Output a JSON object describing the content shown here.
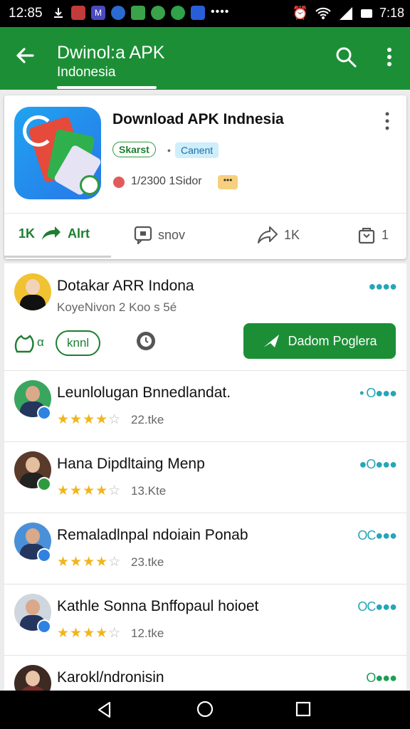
{
  "status_bar": {
    "time": "12:85",
    "right_time": "7:18",
    "icons": [
      "download-icon",
      "flag-icon",
      "m-icon",
      "shield-icon",
      "chat-icon",
      "whatsapp-icon",
      "leaf-icon",
      "calendar-icon",
      "more-dots-icon"
    ],
    "right_icons": [
      "alarm-icon",
      "wifi-icon",
      "signal-icon",
      "battery-icon"
    ]
  },
  "app_bar": {
    "title": "Dwinol:a APK",
    "subtitle": "Indonesia"
  },
  "app_card": {
    "title": "Download APK Indnesia",
    "tag_primary": "Skarst",
    "tag_secondary": "Canent",
    "info_text": "1/2300 1Sidor",
    "info_badge": "•••",
    "actions": [
      {
        "count": "1K",
        "label": "Alrt"
      },
      {
        "label": "snov"
      },
      {
        "label": "1K"
      },
      {
        "label": "1"
      }
    ]
  },
  "first_row": {
    "name": "Dotakar ARR Indona",
    "sub": "KoyeNivon 2 Koo s 5é",
    "status": "●●●●",
    "like_count": "α",
    "pill_label": "knnl",
    "button_label": "Dadom Poglera"
  },
  "rows": [
    {
      "name": "Leunlolugan Bnnedlandat.",
      "rating": 3.5,
      "count": "22.tke",
      "status": "• O●●●",
      "badge": "blue"
    },
    {
      "name": "Hana Dipdltaing Menp",
      "rating": 3.5,
      "count": "13.Kte",
      "status": "●O●●●",
      "badge": "green"
    },
    {
      "name": "Remaladlnpal ndoiain Ponab",
      "rating": 3.5,
      "count": "23.tke",
      "status": "OC●●●",
      "badge": "blue"
    },
    {
      "name": "Kathle Sonna Bnffopaul hoioet",
      "rating": 3.5,
      "count": "12.tke",
      "status": "OC●●●",
      "badge": "blue"
    },
    {
      "name": "Karokl/ndronisin",
      "rating": 0,
      "count": "",
      "status": "O●●●",
      "badge": "none"
    }
  ],
  "colors": {
    "brand_green": "#1c8f36",
    "accent_teal": "#26a6b8",
    "star_yellow": "#f1b51c"
  }
}
